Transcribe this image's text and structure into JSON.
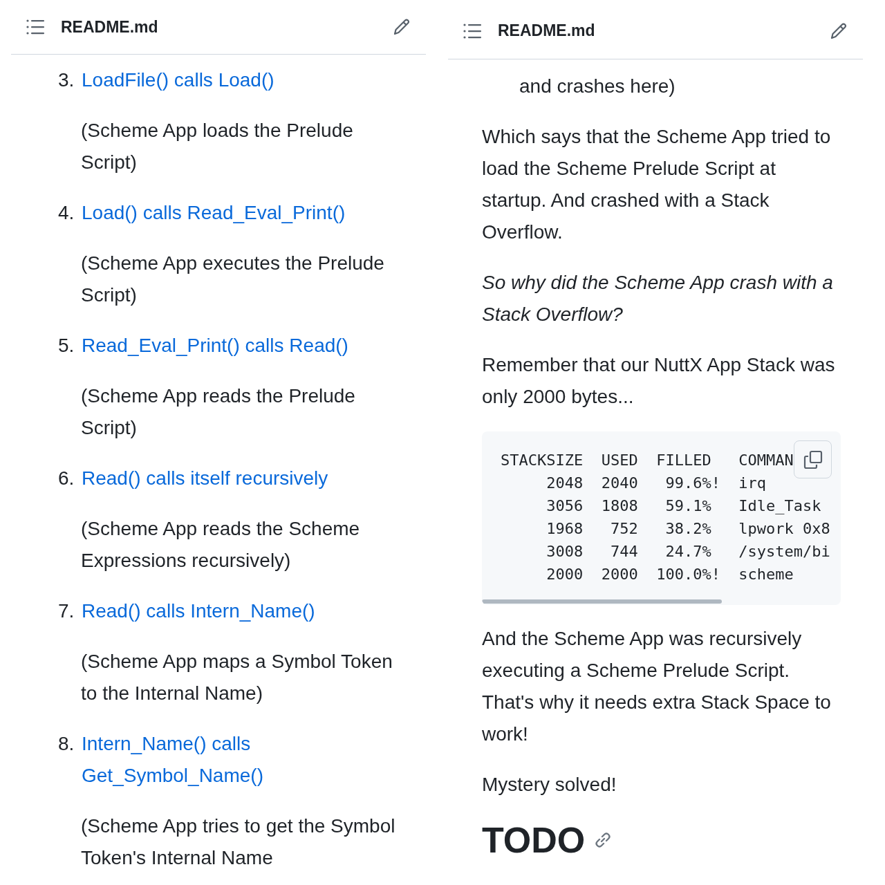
{
  "panes": [
    {
      "header": {
        "title": "README.md"
      },
      "blocks": [
        {
          "kind": "list_item",
          "number": "3.",
          "link": "LoadFile() calls Load()",
          "note": "(Scheme App loads the Prelude Script)"
        },
        {
          "kind": "list_item",
          "number": "4.",
          "link": "Load() calls Read_Eval_Print()",
          "note": "(Scheme App executes the Prelude Script)"
        },
        {
          "kind": "list_item",
          "number": "5.",
          "link": "Read_Eval_Print() calls Read()",
          "note": "(Scheme App reads the Prelude Script)"
        },
        {
          "kind": "list_item",
          "number": "6.",
          "link": "Read() calls itself recursively",
          "note": "(Scheme App reads the Scheme Expressions recursively)"
        },
        {
          "kind": "list_item",
          "number": "7.",
          "link": "Read() calls Intern_Name()",
          "note": "(Scheme App maps a Symbol Token to the Internal Name)"
        },
        {
          "kind": "list_item",
          "number": "8.",
          "link": "Intern_Name() calls Get_Symbol_Name()",
          "note": "(Scheme App tries to get the Symbol Token's Internal Name"
        }
      ]
    },
    {
      "header": {
        "title": "README.md"
      },
      "blocks": [
        {
          "kind": "continuation",
          "text": "and crashes here)"
        },
        {
          "kind": "paragraph",
          "text": "Which says that the Scheme App tried to load the Scheme Prelude Script at startup. And crashed with a Stack Overflow."
        },
        {
          "kind": "emphasis",
          "text": "So why did the Scheme App crash with a Stack Overflow?"
        },
        {
          "kind": "paragraph",
          "text": "Remember that our NuttX App Stack was only 2000 bytes..."
        },
        {
          "kind": "code",
          "lines": [
            "STACKSIZE  USED  FILLED   COMMAN",
            "     2048  2040   99.6%!  irq",
            "     3056  1808   59.1%   Idle_Task",
            "     1968   752   38.2%   lpwork 0x8",
            "     3008   744   24.7%   /system/bi",
            "     2000  2000  100.0%!  scheme"
          ]
        },
        {
          "kind": "paragraph",
          "text": "And the Scheme App was recursively executing a Scheme Prelude Script. That's why it needs extra Stack Space to work!"
        },
        {
          "kind": "paragraph",
          "text": "Mystery solved!"
        },
        {
          "kind": "heading",
          "text": "TODO"
        }
      ]
    }
  ]
}
